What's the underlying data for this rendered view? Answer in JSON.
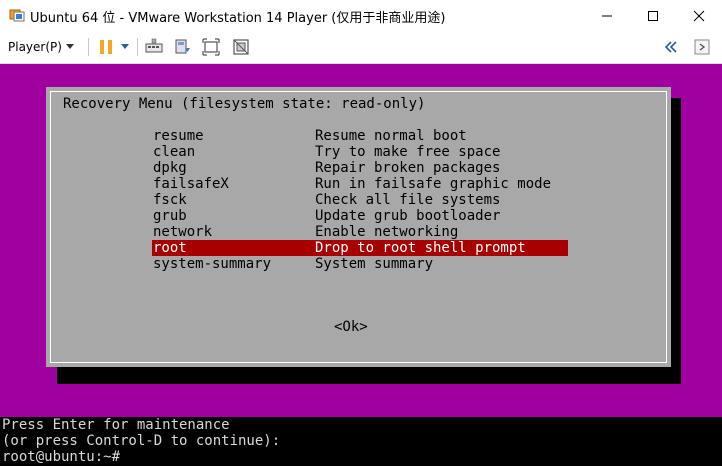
{
  "window": {
    "title": "Ubuntu 64 位 - VMware Workstation 14 Player (仅用于非商业用途)",
    "controls": [
      "minimize-icon",
      "maximize-icon",
      "close-icon"
    ]
  },
  "toolbar": {
    "player_menu": "Player(P)",
    "icons": [
      "pause-icon",
      "dropdown-arrow-icon",
      "send-ctrl-alt-del-icon",
      "removable-devices-icon",
      "fullscreen-icon",
      "unity-icon",
      "collapse-icon",
      "help-icon"
    ]
  },
  "recovery": {
    "title": "Recovery Menu (filesystem state: read-only)",
    "items": [
      {
        "key": "resume",
        "desc": "Resume normal boot"
      },
      {
        "key": "clean",
        "desc": "Try to make free space"
      },
      {
        "key": "dpkg",
        "desc": "Repair broken packages"
      },
      {
        "key": "failsafeX",
        "desc": "Run in failsafe graphic mode"
      },
      {
        "key": "fsck",
        "desc": "Check all file systems"
      },
      {
        "key": "grub",
        "desc": "Update grub bootloader"
      },
      {
        "key": "network",
        "desc": "Enable networking"
      },
      {
        "key": "root",
        "desc": "Drop to root shell prompt"
      },
      {
        "key": "system-summary",
        "desc": "System summary"
      }
    ],
    "selected": "root",
    "ok": "<Ok>"
  },
  "console": {
    "lines": [
      "Press Enter for maintenance",
      "(or press Control-D to continue):",
      "root@ubuntu:~#"
    ]
  },
  "colors": {
    "vm_background": "#a000a0",
    "dialog_background": "#a8a8a8",
    "selection": "#a80000",
    "toolbar_accent": "#f5a623"
  }
}
